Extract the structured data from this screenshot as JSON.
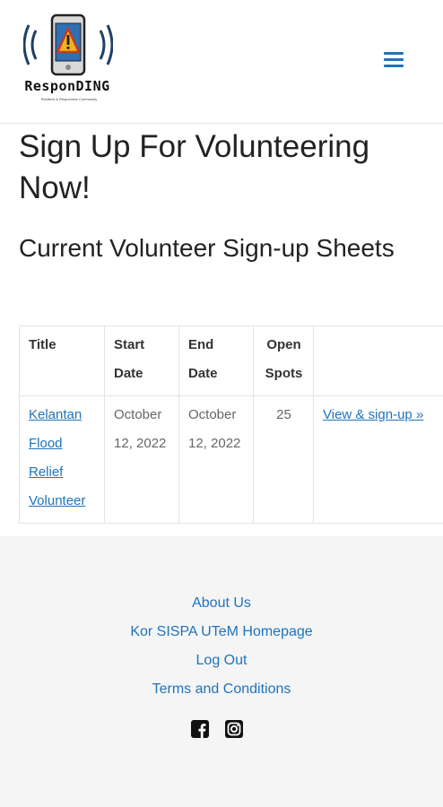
{
  "brand": {
    "name": "ResponDING",
    "tagline": "Resilient & Responsive Community",
    "colors": {
      "accent": "#1e73be",
      "phone": "#2f5f9c",
      "warning": "#f2b21b",
      "waves": "#1f3f66"
    }
  },
  "header": {
    "menu_icon": "hamburger-menu-icon"
  },
  "page": {
    "title": "Sign Up For Volunteering Now!",
    "section_title": "Current Volunteer Sign-up Sheets"
  },
  "table": {
    "headers": {
      "title": "Title",
      "start_date": "Start Date",
      "end_date": "End Date",
      "open_spots": "Open Spots",
      "action": ""
    },
    "rows": [
      {
        "title": "Kelantan Flood Relief Volunteer",
        "start_date": "October 12, 2022",
        "end_date": "October 12, 2022",
        "open_spots": "25",
        "action": "View & sign-up »"
      }
    ]
  },
  "footer": {
    "links": [
      "About Us",
      "Kor SISPA UTeM Homepage",
      "Log Out",
      "Terms and Conditions"
    ],
    "social_icons": [
      "facebook-icon",
      "instagram-icon"
    ]
  }
}
